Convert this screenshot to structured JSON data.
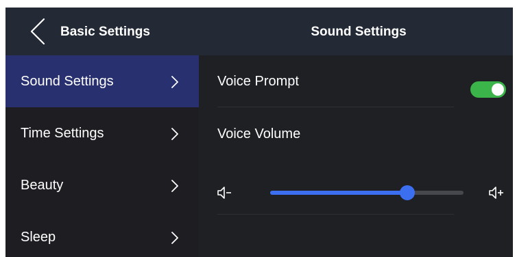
{
  "header": {
    "back_label": "Basic Settings",
    "page_title": "Sound Settings"
  },
  "sidebar": {
    "items": [
      {
        "label": "Sound Settings",
        "active": true
      },
      {
        "label": "Time Settings",
        "active": false
      },
      {
        "label": "Beauty",
        "active": false
      },
      {
        "label": "Sleep",
        "active": false
      }
    ]
  },
  "sound": {
    "voice_prompt_label": "Voice Prompt",
    "voice_prompt_enabled": true,
    "voice_volume_label": "Voice Volume",
    "volume_level_percent": 71
  },
  "icons": {
    "back": "chevron-left-icon",
    "menu_chevron": "chevron-right-icon",
    "volume_down": "volume-down-icon",
    "volume_up": "volume-up-icon"
  },
  "colors": {
    "header_bg": "#232a36",
    "active_item_bg": "#283070",
    "toggle_on": "#3bb54a",
    "slider_accent": "#3c6ff0"
  }
}
